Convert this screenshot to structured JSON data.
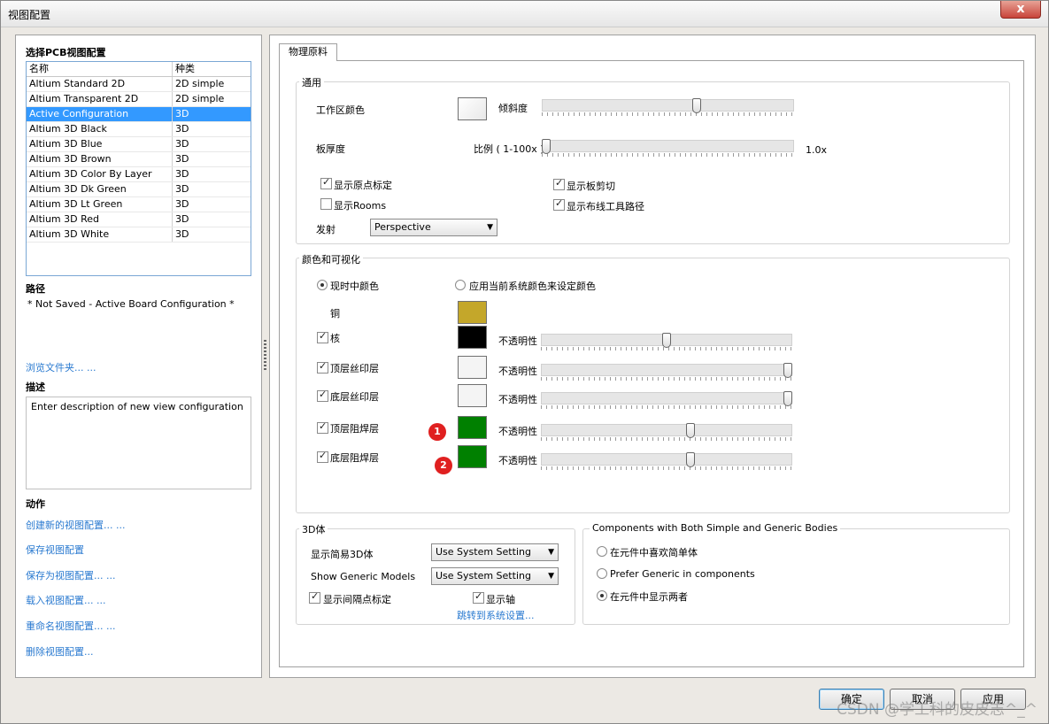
{
  "window": {
    "title": "视图配置",
    "close_label": "x"
  },
  "left": {
    "select_heading": "选择PCB视图配置",
    "columns": {
      "name": "名称",
      "kind": "种类"
    },
    "configs": [
      {
        "name": "Altium Standard 2D",
        "kind": "2D simple"
      },
      {
        "name": "Altium Transparent 2D",
        "kind": "2D simple"
      },
      {
        "name": "Active Configuration",
        "kind": "3D"
      },
      {
        "name": "Altium 3D Black",
        "kind": "3D"
      },
      {
        "name": "Altium 3D Blue",
        "kind": "3D"
      },
      {
        "name": "Altium 3D Brown",
        "kind": "3D"
      },
      {
        "name": "Altium 3D Color By Layer",
        "kind": "3D"
      },
      {
        "name": "Altium 3D Dk Green",
        "kind": "3D"
      },
      {
        "name": "Altium 3D Lt Green",
        "kind": "3D"
      },
      {
        "name": "Altium 3D Red",
        "kind": "3D"
      },
      {
        "name": "Altium 3D White",
        "kind": "3D"
      }
    ],
    "path_heading": "路径",
    "path_value": "* Not Saved - Active Board Configuration *",
    "browse_link": "浏览文件夹... ...",
    "desc_heading": "描述",
    "desc_value": "Enter description of new view configuration",
    "actions_heading": "动作",
    "actions": [
      "创建新的视图配置... ...",
      "保存视图配置",
      "保存为视图配置... ...",
      "载入视图配置... ...",
      "重命名视图配置... ...",
      "删除视图配置..."
    ]
  },
  "right": {
    "tab": "物理原料",
    "general": {
      "title": "通用",
      "workspace_color": "工作区颜色",
      "tilt": "倾斜度",
      "board_thickness": "板厚度",
      "scale": "比例 ( 1-100x )",
      "scale_value": "1.0x",
      "show_origin": "显示原点标定",
      "show_rooms": "显示Rooms",
      "show_board_cut": "显示板剪切",
      "show_route_path": "显示布线工具路径",
      "projection_label": "发射",
      "projection_value": "Perspective"
    },
    "colors": {
      "title": "颜色和可视化",
      "realtime": "现时中颜色",
      "system_colors": "应用当前系统颜色来设定颜色",
      "opacity": "不透明性",
      "copper": "铜",
      "core": "核",
      "top_silk": "顶层丝印层",
      "bottom_silk": "底层丝印层",
      "top_mask": "顶层阻焊层",
      "bottom_mask": "底层阻焊层",
      "badge1": "1",
      "badge2": "2",
      "copper_color": "#c4a72a",
      "core_color": "#000000",
      "silk_color": "#f4f4f4",
      "mask_color": "#008000",
      "opacity_core": 0.5,
      "opacity_top_silk": 1.0,
      "opacity_bottom_silk": 1.0,
      "opacity_top_mask": 0.6,
      "opacity_bottom_mask": 0.6
    },
    "body3d": {
      "title": "3D体",
      "simple_label": "显示简易3D体",
      "simple_value": "Use System Setting",
      "generic_label": "Show Generic Models",
      "generic_value": "Use System Setting",
      "show_snap": "显示间隔点标定",
      "show_axis": "显示轴",
      "goto_link": "跳转到系统设置..."
    },
    "components": {
      "title": "Components with Both Simple and Generic Bodies",
      "opt1": "在元件中喜欢简单体",
      "opt2": "Prefer Generic in components",
      "opt3": "在元件中显示两者"
    }
  },
  "buttons": {
    "ok": "确定",
    "cancel": "取消",
    "apply": "应用"
  },
  "watermark": "CSDN @学工科的皮皮志^_^"
}
